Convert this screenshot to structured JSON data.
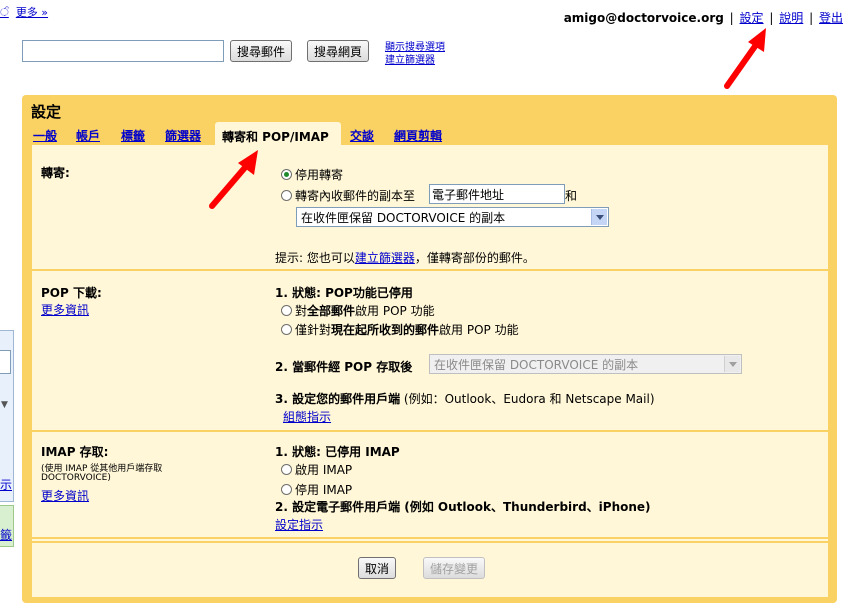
{
  "header": {
    "left_partial": "ੰ",
    "more_link": "更多 »",
    "email": "amigo@doctorvoice.org",
    "links": [
      "設定",
      "說明",
      "登出"
    ]
  },
  "search": {
    "input_value": "",
    "search_mail": "搜尋郵件",
    "search_web": "搜尋網頁",
    "show_options": "顯示搜尋選項",
    "create_filter": "建立篩選器"
  },
  "settings": {
    "title": "設定",
    "tabs": [
      "一般",
      "帳戶",
      "標籤",
      "篩選器",
      "轉寄和 POP/IMAP",
      "交談",
      "網頁剪輯"
    ],
    "active_tab": "轉寄和 POP/IMAP"
  },
  "forwarding": {
    "label": "轉寄:",
    "opt_disable": "停用轉寄",
    "opt_forward": "轉寄內收郵件的副本至",
    "email_placeholder": "電子郵件地址",
    "and_text": "和",
    "keep_select": "在收件匣保留 DOCTORVOICE 的副本",
    "tip_prefix": "提示: 您也可以",
    "tip_link": "建立篩選器",
    "tip_suffix": "，僅轉寄部份的郵件。"
  },
  "pop": {
    "label": "POP 下載:",
    "more_info": "更多資訊",
    "status": "1. 狀態: POP功能已停用",
    "opt_all_prefix": "對",
    "opt_all_bold": "全部郵件",
    "opt_all_suffix": "啟用 POP 功能",
    "opt_now_prefix": "僅針對",
    "opt_now_bold": "現在起所收到的郵件",
    "opt_now_suffix": "啟用 POP 功能",
    "step2": "2. 當郵件經 POP 存取後",
    "step2_select": "在收件匣保留 DOCTORVOICE 的副本",
    "step3_bold": "3. 設定您的郵件用戶端",
    "step3_rest": " (例如：Outlook、Eudora 和 Netscape Mail)",
    "config_link": "組態指示"
  },
  "imap": {
    "label": "IMAP 存取:",
    "sub1": "(使用 IMAP 從其他用戶端存取",
    "sub2": "DOCTORVOICE)",
    "more_info": "更多資訊",
    "status": "1. 狀態: 已停用 IMAP",
    "opt_enable": "啟用 IMAP",
    "opt_disable": "停用 IMAP",
    "step2": "2. 設定電子郵件用戶端 (例如 Outlook、Thunderbird、iPhone)",
    "config_link": "設定指示"
  },
  "actions": {
    "cancel": "取消",
    "save": "儲存變更"
  },
  "left_partial": {
    "item1": "示",
    "item2": "籤"
  },
  "colors": {
    "panel": "#fad163",
    "content": "#fff7d7",
    "link": "#0000cc",
    "arrow": "#ff0000"
  }
}
